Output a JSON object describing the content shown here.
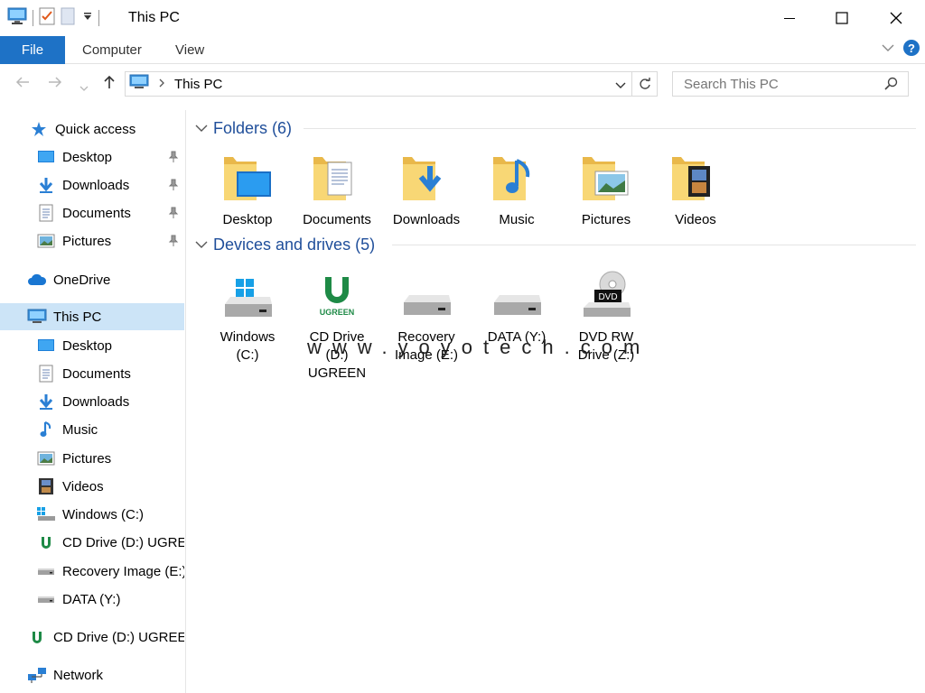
{
  "window": {
    "title": "This PC"
  },
  "ribbon": {
    "tabs": [
      "File",
      "Computer",
      "View"
    ]
  },
  "address": {
    "path": "This PC"
  },
  "search": {
    "placeholder": "Search This PC"
  },
  "sidebar": {
    "items": [
      {
        "label": "Quick access",
        "icon": "star-icon",
        "pinned": false
      },
      {
        "label": "Desktop",
        "icon": "desktop-icon",
        "pinned": true
      },
      {
        "label": "Downloads",
        "icon": "download-arrow-icon",
        "pinned": true
      },
      {
        "label": "Documents",
        "icon": "document-icon",
        "pinned": true
      },
      {
        "label": "Pictures",
        "icon": "picture-icon",
        "pinned": true
      },
      {
        "label": "OneDrive",
        "icon": "cloud-icon",
        "pinned": false
      },
      {
        "label": "This PC",
        "icon": "computer-icon",
        "pinned": false,
        "selected": true
      },
      {
        "label": "Desktop",
        "icon": "desktop-icon"
      },
      {
        "label": "Documents",
        "icon": "document-icon"
      },
      {
        "label": "Downloads",
        "icon": "download-arrow-icon"
      },
      {
        "label": "Music",
        "icon": "music-note-icon"
      },
      {
        "label": "Pictures",
        "icon": "picture-icon"
      },
      {
        "label": "Videos",
        "icon": "film-icon"
      },
      {
        "label": "Windows (C:)",
        "icon": "windows-drive-icon"
      },
      {
        "label": "CD Drive (D:) UGREEN",
        "icon": "ugreen-icon"
      },
      {
        "label": "Recovery Image (E:)",
        "icon": "drive-icon"
      },
      {
        "label": "DATA (Y:)",
        "icon": "drive-icon"
      },
      {
        "label": "CD Drive (D:) UGREEN",
        "icon": "ugreen-icon"
      },
      {
        "label": "Network",
        "icon": "network-icon"
      }
    ]
  },
  "folders": {
    "header": "Folders (6)",
    "items": [
      {
        "label": "Desktop",
        "icon": "desktop-folder-icon"
      },
      {
        "label": "Documents",
        "icon": "documents-folder-icon"
      },
      {
        "label": "Downloads",
        "icon": "downloads-folder-icon"
      },
      {
        "label": "Music",
        "icon": "music-folder-icon"
      },
      {
        "label": "Pictures",
        "icon": "pictures-folder-icon"
      },
      {
        "label": "Videos",
        "icon": "videos-folder-icon"
      }
    ]
  },
  "drives": {
    "header": "Devices and drives (5)",
    "items": [
      {
        "label": "Windows (C:)",
        "icon": "windows-drive-icon"
      },
      {
        "label": "CD Drive (D:) UGREEN",
        "icon": "ugreen-cd-drive-icon"
      },
      {
        "label": "Recovery Image (E:)",
        "icon": "hard-drive-icon"
      },
      {
        "label": "DATA (Y:)",
        "icon": "hard-drive-icon"
      },
      {
        "label": "DVD RW Drive (Z:)",
        "icon": "dvd-drive-icon"
      }
    ]
  },
  "watermark": "www.yoyotech.com",
  "colors": {
    "accent": "#1e72c6",
    "selected": "#cce4f7",
    "header": "#1f4e9a",
    "folder": "#f6cf6b"
  }
}
